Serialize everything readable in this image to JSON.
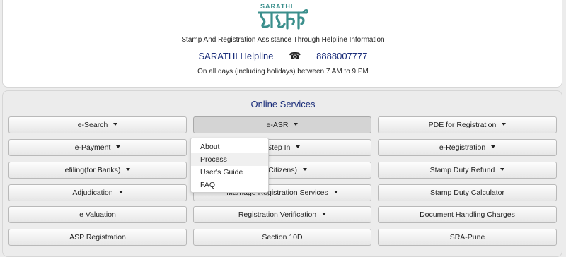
{
  "header": {
    "logo_small_text": "SARATHI",
    "logo_devanagari": "सारथी",
    "tagline": "Stamp And Registration Assistance Through Helpline Information",
    "helpline_label": "SARATHI Helpline",
    "phone_icon": "☎",
    "phone_number": "8888007777",
    "hours": "On all days (including holidays) between 7 AM to 9 PM"
  },
  "services": {
    "title": "Online Services",
    "buttons": [
      {
        "label": "e-Search",
        "dropdown": true
      },
      {
        "label": "e-ASR",
        "dropdown": true,
        "active": true
      },
      {
        "label": "PDE for Registration",
        "dropdown": true
      },
      {
        "label": "e-Payment",
        "dropdown": true
      },
      {
        "label": "-Step In",
        "dropdown": true
      },
      {
        "label": "e-Registration",
        "dropdown": true
      },
      {
        "label": "efiling(for Banks)",
        "dropdown": true
      },
      {
        "label": "for Citizens)",
        "dropdown": true
      },
      {
        "label": "Stamp Duty Refund",
        "dropdown": true
      },
      {
        "label": "Adjudication",
        "dropdown": true
      },
      {
        "label": "Marriage Registration Services",
        "dropdown": true
      },
      {
        "label": "Stamp Duty Calculator",
        "dropdown": false
      },
      {
        "label": "e Valuation",
        "dropdown": false
      },
      {
        "label": "Registration Verification",
        "dropdown": true
      },
      {
        "label": "Document Handling Charges",
        "dropdown": false
      },
      {
        "label": "ASP Registration",
        "dropdown": false
      },
      {
        "label": "Section 10D",
        "dropdown": false
      },
      {
        "label": "SRA-Pune",
        "dropdown": false
      }
    ]
  },
  "dropdown_menu": {
    "items": [
      "About",
      "Process",
      "User's Guide",
      "FAQ"
    ],
    "hovered": "Process"
  },
  "colors": {
    "accent_blue": "#1a2d7a",
    "logo_teal": "#3b8f8c",
    "panel_bg": "#ececec"
  }
}
